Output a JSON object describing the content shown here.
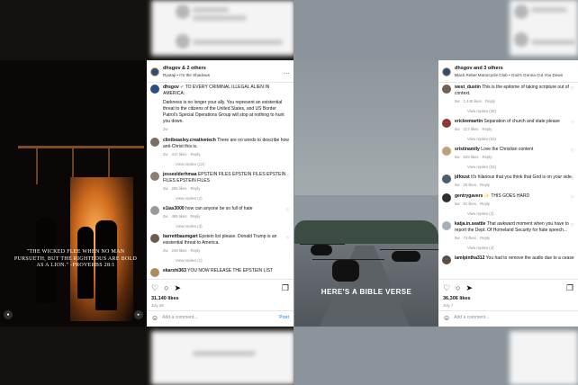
{
  "left_post": {
    "header": {
      "username": "dhsgov",
      "collab": "& 2 others",
      "subtitle": "Ryutaji • I'm the Shadows"
    },
    "caption": {
      "username": "dhsgov",
      "verified": "✔",
      "title": "TO EVERY CRIMINAL ILLEGAL ALIEN IN AMERICA:",
      "body": "Darkness is no longer your ally. You represent an existential threat to the citizens of the United States, and US Border Patrol's Special Operations Group will stop at nothing to hunt you down.",
      "age": "2w"
    },
    "media_quote": "\"THE WICKED FLEE WHEN NO MAN PURSUETH, BUT THE RIGHTEOUS ARE BOLD AS A LION.\" -PROVERBS 28:1",
    "comments": [
      {
        "user": "clintbeasley.creativetech",
        "text": "There are no words to describe how anti-Christ this is.",
        "age": "2w",
        "likes": "417 likes",
        "reply": "Reply",
        "replies": "View replies (12)"
      },
      {
        "user": "jesseelderhmaa",
        "text": "EPSTEIN FILES EPSTEIN FILES EPSTEIN FILES EPSTEIN FILES",
        "age": "2w",
        "likes": "295 likes",
        "reply": "Reply",
        "replies": "View replies (2)"
      },
      {
        "user": "e1ias3000",
        "text": "how can anyone be so full of hate",
        "age": "2w",
        "likes": "498 likes",
        "reply": "Reply",
        "replies": "View replies (3)"
      },
      {
        "user": "barrettbaumgart",
        "text": "Epstein list please. Donald Trump is an existential threat to America.",
        "age": "2w",
        "likes": "249 likes",
        "reply": "Reply",
        "replies": "View replies (1)"
      },
      {
        "user": "ekarshi363",
        "text": "YOU NOW RELEASE THE EPSTEIN LIST",
        "age": "",
        "likes": "",
        "reply": "",
        "replies": ""
      }
    ],
    "likes": "31,140 likes",
    "date": "July 28",
    "add_comment": "Add a comment...",
    "post_label": "Post"
  },
  "right_post": {
    "header": {
      "username": "dhsgov",
      "collab": "and 3 others",
      "subtitle": "Black Rebel Motorcycle Club • God's Gonna Cut You Down"
    },
    "media_overlay": "HERE'S A BIBLE VERSE",
    "comments": [
      {
        "user": "west_dustin",
        "text": "This is the epitome of taking scripture out of context.",
        "age": "5w",
        "likes": "1,445 likes",
        "reply": "Reply",
        "replies": "View replies (38)"
      },
      {
        "user": "ericleemartin",
        "text": "Separation of church and state please",
        "age": "5w",
        "likes": "317 likes",
        "reply": "Reply",
        "replies": "View replies (83)"
      },
      {
        "user": "sristinamlly",
        "text": "Love the Christian content",
        "age": "5w",
        "likes": "629 likes",
        "reply": "Reply",
        "replies": "View replies (53)"
      },
      {
        "user": "jdfoust",
        "text": "It's hilarious that you think that God is on your side.",
        "age": "5w",
        "likes": "29 likes",
        "reply": "Reply",
        "replies": ""
      },
      {
        "user": "gentrygavers",
        "text": "✨ THIS GOES HARD",
        "age": "5w",
        "likes": "91 likes",
        "reply": "Reply",
        "replies": "View replies (3)"
      },
      {
        "user": "katja.in.seattle",
        "text": "That awkward moment when you have to report the Dept. Of Homeland Security for hate speech...",
        "age": "5w",
        "likes": "73 likes",
        "reply": "Reply",
        "replies": "View replies (4)"
      },
      {
        "user": "iamlpintha312",
        "text": "You had to remove the audio due to a cease",
        "age": "",
        "likes": "",
        "reply": "",
        "replies": ""
      }
    ],
    "likes": "36,306 likes",
    "date": "July 7",
    "add_comment": "Add a comment..."
  },
  "icons": {
    "heart": "♡",
    "comment": "○",
    "share": "➤",
    "save": "❐",
    "more": "…",
    "emoji": "☺",
    "mute": "▸",
    "user": "●",
    "like_small": "♡"
  }
}
